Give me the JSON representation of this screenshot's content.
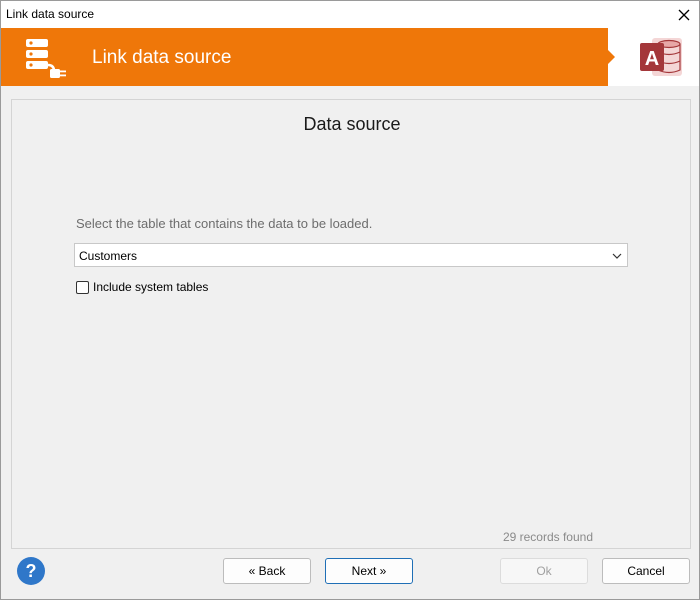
{
  "window": {
    "title": "Link data source"
  },
  "banner": {
    "heading": "Link data source",
    "accent_color": "#ef7709"
  },
  "icons": {
    "close": "close-icon",
    "database": "database-plug-icon",
    "access": "ms-access-icon",
    "help": "help-icon",
    "dropdown": "chevron-down-icon"
  },
  "panel": {
    "section_title": "Data source",
    "instruction": "Select the table that contains the data to be loaded.",
    "table_select": {
      "value": "Customers"
    },
    "include_system_tables": {
      "label": "Include system tables",
      "checked": false
    },
    "status": "29 records found"
  },
  "footer": {
    "back_label": "« Back",
    "next_label": "Next »",
    "ok_label": "Ok",
    "cancel_label": "Cancel"
  }
}
